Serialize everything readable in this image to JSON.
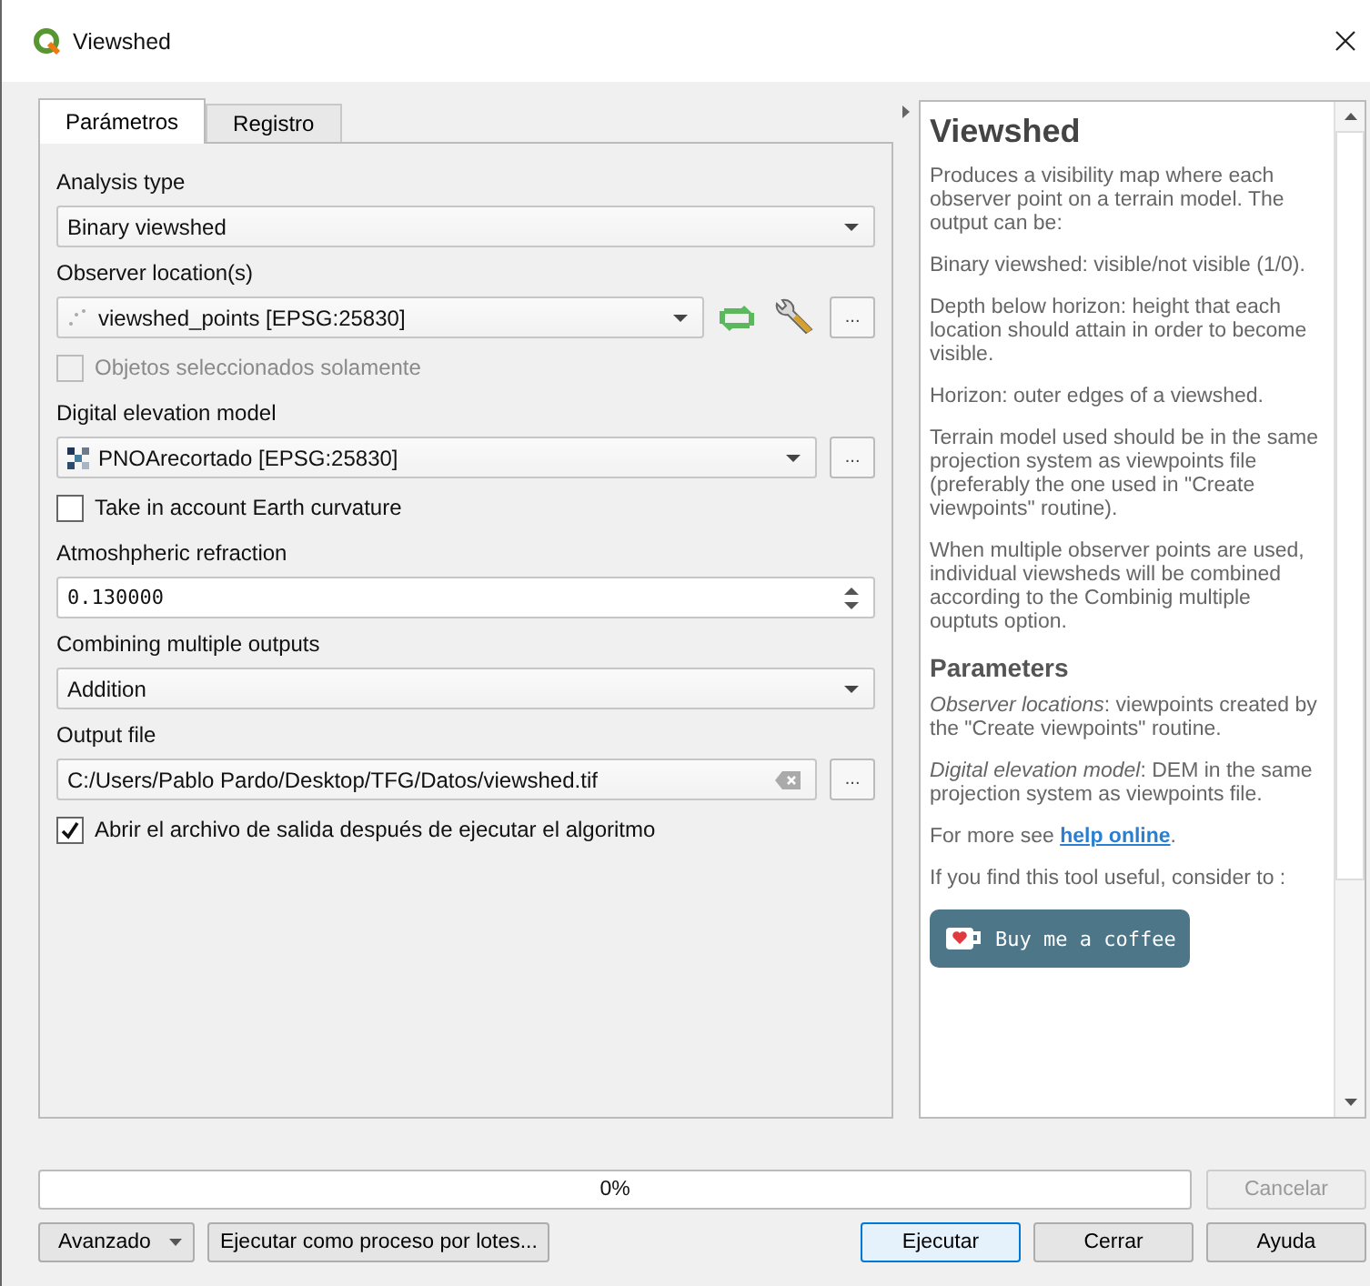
{
  "window": {
    "title": "Viewshed"
  },
  "tabs": [
    {
      "label": "Parámetros",
      "selected": true
    },
    {
      "label": "Registro",
      "selected": false
    }
  ],
  "form": [
    {
      "kind": "label",
      "text": "Analysis type"
    },
    {
      "kind": "combo",
      "value": "Binary viewshed"
    },
    {
      "kind": "label",
      "text": "Observer location(s)"
    },
    {
      "kind": "point_layer_tools",
      "value": "viewshed_points [EPSG:25830]",
      "browse": "..."
    },
    {
      "kind": "checkbox",
      "text": "Objetos seleccionados solamente",
      "checked": false,
      "disabled": true
    },
    {
      "kind": "label",
      "text": "Digital elevation model"
    },
    {
      "kind": "raster_layer",
      "value": "PNOArecortado [EPSG:25830]",
      "browse": "..."
    },
    {
      "kind": "checkbox",
      "text": "Take in account Earth curvature",
      "checked": false,
      "disabled": false
    },
    {
      "kind": "label",
      "text": "Atmoshpheric refraction"
    },
    {
      "kind": "spin",
      "value": "0.130000"
    },
    {
      "kind": "label",
      "text": "Combining multiple outputs"
    },
    {
      "kind": "combo",
      "value": "Addition"
    },
    {
      "kind": "label",
      "text": "Output file"
    },
    {
      "kind": "file",
      "value": "C:/Users/Pablo Pardo/Desktop/TFG/Datos/viewshed.tif",
      "browse": "..."
    },
    {
      "kind": "checkbox",
      "text": "Abrir el archivo de salida después de ejecutar el algoritmo",
      "checked": true,
      "disabled": false
    }
  ],
  "help": [
    {
      "kind": "title",
      "text": "Viewshed"
    },
    {
      "kind": "para",
      "text": "Produces a visibility map where each observer point on a terrain model. The output can be:"
    },
    {
      "kind": "para",
      "text": "Binary viewshed: visible/not visible (1/0)."
    },
    {
      "kind": "para",
      "text": "Depth below horizon: height that each location should attain in order to become visible."
    },
    {
      "kind": "para",
      "text": "Horizon: outer edges of a viewshed."
    },
    {
      "kind": "para",
      "text": "Terrain model used should be in the same projection system as viewpoints file (preferably the one used in \"Create viewpoints\" routine)."
    },
    {
      "kind": "para",
      "text": "When multiple observer points are used, individual viewsheds will be combined according to the Combinig multiple ouptuts option."
    },
    {
      "kind": "heading",
      "text": "Parameters"
    },
    {
      "kind": "para",
      "text": "*Observer locations*: viewpoints created by the \"Create viewpoints\" routine."
    },
    {
      "kind": "para",
      "text": "*Digital elevation model*: DEM in the same projection system as viewpoints file."
    },
    {
      "kind": "link_para",
      "before": "For more see ",
      "link": "help online",
      "after": "."
    },
    {
      "kind": "para",
      "text": "If you find this tool useful, consider to :"
    },
    {
      "kind": "coffee",
      "text": "Buy me a coffee"
    }
  ],
  "progress": {
    "text": "0%"
  },
  "cancel_button": {
    "label": "Cancelar",
    "disabled": true
  },
  "buttons": [
    {
      "label": "Avanzado",
      "kind": "menu"
    },
    {
      "label": "Ejecutar como proceso por lotes...",
      "kind": "plain"
    },
    {
      "label": "Ejecutar",
      "kind": "default"
    },
    {
      "label": "Cerrar",
      "kind": "plain"
    },
    {
      "label": "Ayuda",
      "kind": "plain"
    }
  ]
}
